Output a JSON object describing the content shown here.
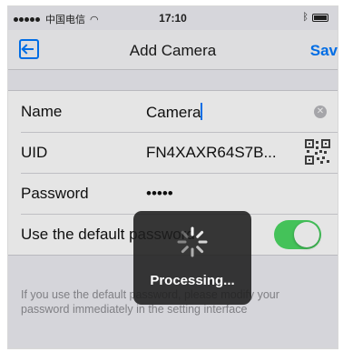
{
  "status_bar": {
    "carrier": "中国电信",
    "time": "17:10"
  },
  "nav": {
    "title": "Add Camera",
    "save_label": "Sav"
  },
  "form": {
    "name_label": "Name",
    "name_value": "Camera",
    "uid_label": "UID",
    "uid_value": "FN4XAXR64S7B...",
    "password_label": "Password",
    "password_value": "•••••",
    "default_password_label": "Use the default password",
    "default_password_enabled": true,
    "footnote": "If you use the default password, please modify your password immediately in the setting interface"
  },
  "hud": {
    "label": "Processing..."
  },
  "colors": {
    "accent": "#007aff",
    "toggle_on": "#4cd964"
  },
  "icons": [
    "back-icon",
    "clear-icon",
    "qr-code-icon",
    "spinner-icon",
    "wifi-icon",
    "bluetooth-icon",
    "battery-icon"
  ]
}
